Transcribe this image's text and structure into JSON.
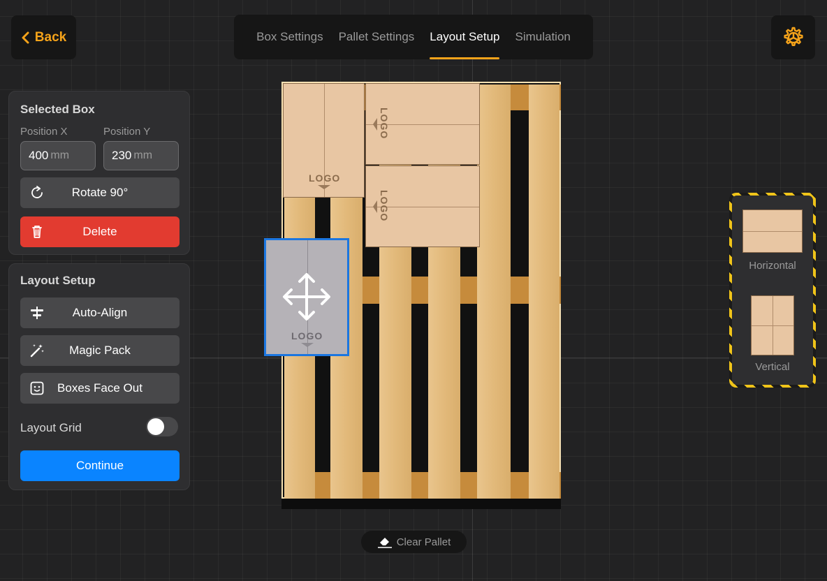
{
  "header": {
    "back_label": "Back",
    "tabs": [
      {
        "label": "Box Settings",
        "active": false
      },
      {
        "label": "Pallet Settings",
        "active": false
      },
      {
        "label": "Layout Setup",
        "active": true
      },
      {
        "label": "Simulation",
        "active": false
      }
    ],
    "settings_icon": "gear-icon"
  },
  "selected_box": {
    "title": "Selected Box",
    "position_x": {
      "label": "Position X",
      "value": "400",
      "unit": "mm"
    },
    "position_y": {
      "label": "Position Y",
      "value": "230",
      "unit": "mm"
    },
    "rotate_label": "Rotate 90°",
    "delete_label": "Delete"
  },
  "layout_setup": {
    "title": "Layout Setup",
    "auto_align_label": "Auto-Align",
    "magic_pack_label": "Magic Pack",
    "boxes_face_out_label": "Boxes Face Out",
    "layout_grid_label": "Layout Grid",
    "layout_grid_on": false,
    "continue_label": "Continue"
  },
  "canvas": {
    "box_logo_text": "LOGO",
    "clear_pallet_label": "Clear Pallet"
  },
  "orientation": {
    "horizontal_label": "Horizontal",
    "vertical_label": "Vertical"
  },
  "colors": {
    "accent": "#f5a31a",
    "danger": "#e23b30",
    "primary": "#0a84ff",
    "selection": "#1b76e0"
  }
}
